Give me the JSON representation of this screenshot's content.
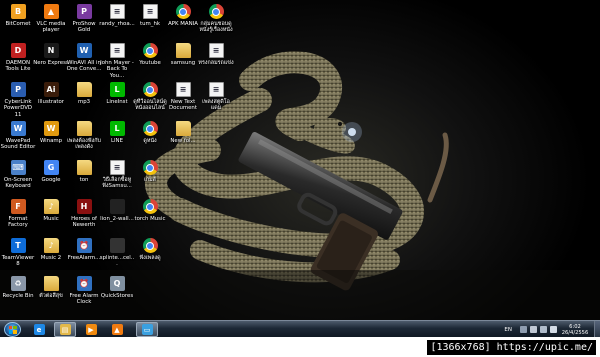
{
  "desktop": {
    "icons": [
      {
        "label": "BitComet",
        "icon": "bitcomet-icon",
        "color": "#f0a020",
        "glyph": "B"
      },
      {
        "label": "DAEMON Tools Lite",
        "icon": "daemon-tools-icon",
        "color": "#c02020",
        "glyph": "D"
      },
      {
        "label": "CyberLink PowerDVD 11",
        "icon": "powerdvd-icon",
        "color": "#2a5db0",
        "glyph": "P"
      },
      {
        "label": "WavePad Sound Editor",
        "icon": "wavepad-icon",
        "color": "#3a7ad0",
        "glyph": "W"
      },
      {
        "label": "On-Screen Keyboard",
        "icon": "keyboard-icon",
        "color": "#4a80c8",
        "glyph": "⌨"
      },
      {
        "label": "Format Factory",
        "icon": "format-factory-icon",
        "color": "#d05a20",
        "glyph": "F"
      },
      {
        "label": "TeamViewer 8",
        "icon": "teamviewer-icon",
        "color": "#0e6cd8",
        "glyph": "T"
      },
      {
        "label": "Recycle Bin",
        "icon": "recycle-bin-icon",
        "color": "#8a97a8",
        "glyph": "♻"
      },
      {
        "label": "VLC media player",
        "icon": "vlc-icon",
        "color": "#f07a10",
        "glyph": "▲"
      },
      {
        "label": "Nero Express",
        "icon": "nero-icon",
        "color": "#1a1a1a",
        "glyph": "N"
      },
      {
        "label": "Illustrator",
        "icon": "illustrator-icon",
        "color": "#3a1c0a",
        "glyph": "Ai"
      },
      {
        "label": "Winamp",
        "icon": "winamp-icon",
        "color": "#e09a10",
        "glyph": "W"
      },
      {
        "label": "Google",
        "icon": "google-icon",
        "color": "#4285f4",
        "glyph": "G"
      },
      {
        "label": "Music",
        "icon": "music-folder-icon",
        "color": "#d9a93b",
        "glyph": "♪"
      },
      {
        "label": "Music 2",
        "icon": "music-folder-icon",
        "color": "#d9a93b",
        "glyph": "♪"
      },
      {
        "label": "ตัวต่อสีสุข",
        "icon": "folder-icon",
        "color": "#d9a93b",
        "glyph": ""
      },
      {
        "label": "ProShow Gold",
        "icon": "proshow-icon",
        "color": "#7a3aa0",
        "glyph": "P"
      },
      {
        "label": "WinAVI All in One Conve...",
        "icon": "winavi-icon",
        "color": "#2060b0",
        "glyph": "W"
      },
      {
        "label": "mp3",
        "icon": "folder-icon",
        "color": "#d9a93b",
        "glyph": ""
      },
      {
        "label": "เพลงต้องฟังกับเพลงดัง",
        "icon": "folder-icon",
        "color": "#d9a93b",
        "glyph": ""
      },
      {
        "label": "ton",
        "icon": "folder-icon",
        "color": "#d9a93b",
        "glyph": ""
      },
      {
        "label": "Heroes of Newerth",
        "icon": "hon-icon",
        "color": "#8a1010",
        "glyph": "H"
      },
      {
        "label": "FreeAlarm...",
        "icon": "alarm-icon",
        "color": "#3070c0",
        "glyph": "⏰"
      },
      {
        "label": "Free Alarm Clock",
        "icon": "alarm-icon",
        "color": "#3070c0",
        "glyph": "⏰"
      },
      {
        "label": "randy_rhoa...",
        "icon": "document-icon",
        "color": "#f4f4f4",
        "glyph": ""
      },
      {
        "label": "John Mayer - Back To You...",
        "icon": "document-icon",
        "color": "#f4f4f4",
        "glyph": ""
      },
      {
        "label": "LineInst",
        "icon": "line-installer-icon",
        "color": "#00b900",
        "glyph": "L"
      },
      {
        "label": "LINE",
        "icon": "line-icon",
        "color": "#00b900",
        "glyph": "L"
      },
      {
        "label": "วิธีเลือกซื้อหูฟังSamsu...",
        "icon": "document-icon",
        "color": "#f4f4f4",
        "glyph": ""
      },
      {
        "label": "lion_2-wall...",
        "icon": "image-file-icon",
        "color": "#222222",
        "glyph": ""
      },
      {
        "label": "splinte...cel...",
        "icon": "image-file-icon",
        "color": "#333333",
        "glyph": ""
      },
      {
        "label": "QuickStores",
        "icon": "quickstores-icon",
        "color": "#8090a0",
        "glyph": "Q"
      },
      {
        "label": "tum_hk",
        "icon": "document-icon",
        "color": "#f4f4f4",
        "glyph": ""
      },
      {
        "label": "Youtube",
        "icon": "chrome-icon",
        "color": "",
        "glyph": ""
      },
      {
        "label": "ดูทีวีออนไลน์ดูหนังออนไลน์",
        "icon": "chrome-icon",
        "color": "",
        "glyph": ""
      },
      {
        "label": "ดูหนัง",
        "icon": "chrome-icon",
        "color": "",
        "glyph": ""
      },
      {
        "label": "เกมส์",
        "icon": "chrome-icon",
        "color": "",
        "glyph": ""
      },
      {
        "label": "torch Music",
        "icon": "chrome-icon",
        "color": "",
        "glyph": ""
      },
      {
        "label": "ฟังเพลงดู",
        "icon": "chrome-icon",
        "color": "",
        "glyph": ""
      },
      {
        "label": "APK MANIA",
        "icon": "chrome-icon",
        "color": "",
        "glyph": ""
      },
      {
        "label": "samsung",
        "icon": "folder-icon",
        "color": "#d9a93b",
        "glyph": ""
      },
      {
        "label": "New Text Document",
        "icon": "document-icon",
        "color": "#f4f4f4",
        "glyph": ""
      },
      {
        "label": "New fol...",
        "icon": "folder-icon",
        "color": "#d9a93b",
        "glyph": ""
      },
      {
        "label": "กลุ่มคนชอบดูหนังรู้เรื่องหนัง",
        "icon": "chrome-icon",
        "color": "",
        "glyph": ""
      },
      {
        "label": "ทรงกลมรถแข่ง",
        "icon": "document-icon",
        "color": "#f4f4f4",
        "glyph": ""
      },
      {
        "label": "เพลงสตูดิโอแดม",
        "icon": "document-icon",
        "color": "#f4f4f4",
        "glyph": ""
      }
    ]
  },
  "taskbar": {
    "pinned": [
      {
        "name": "internet-explorer-icon",
        "glyph": "e",
        "color": "#1e88e5",
        "active": false
      },
      {
        "name": "windows-explorer-icon",
        "glyph": "▤",
        "color": "#e2b84a",
        "active": true
      },
      {
        "name": "media-player-icon",
        "glyph": "▶",
        "color": "#f08a10",
        "active": false
      },
      {
        "name": "vlc-taskbar-icon",
        "glyph": "▲",
        "color": "#f07a10",
        "active": false
      },
      {
        "name": "remote-desktop-icon",
        "glyph": "▭",
        "color": "#3aa0e0",
        "active": true
      }
    ],
    "tray": {
      "language": "EN",
      "time": "6:02",
      "date": "26/4/2556"
    }
  },
  "watermark": "[1366x768] https://upic.me/"
}
